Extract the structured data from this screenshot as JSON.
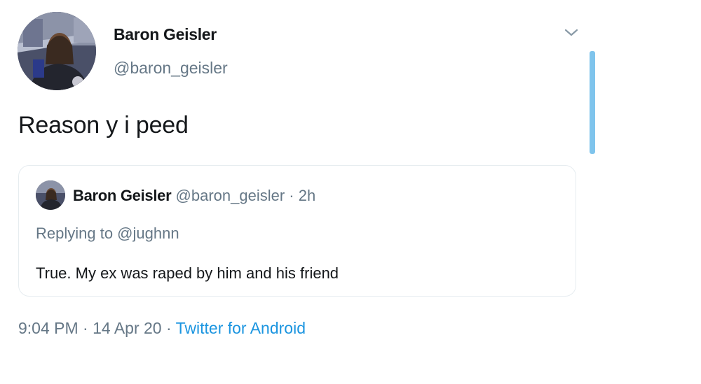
{
  "author": {
    "name": "Baron Geisler",
    "handle": "@baron_geisler"
  },
  "tweet": {
    "text": "Reason y i peed"
  },
  "quoted_tweet": {
    "name": "Baron Geisler",
    "handle": "@baron_geisler",
    "time": "2h",
    "separator": "·",
    "replying_to": "Replying to @jughnn",
    "text": "True. My ex was raped by him and his friend"
  },
  "footer": {
    "time": "9:04 PM",
    "date": "14 Apr 20",
    "source": "Twitter for Android",
    "separator": "·"
  },
  "icons": {
    "menu": "chevron-down-icon"
  },
  "colors": {
    "primary_text": "#14171a",
    "secondary_text": "#657786",
    "link": "#1b95e0",
    "border": "#e6ecf0",
    "scrollbar": "#7fc4ec"
  }
}
